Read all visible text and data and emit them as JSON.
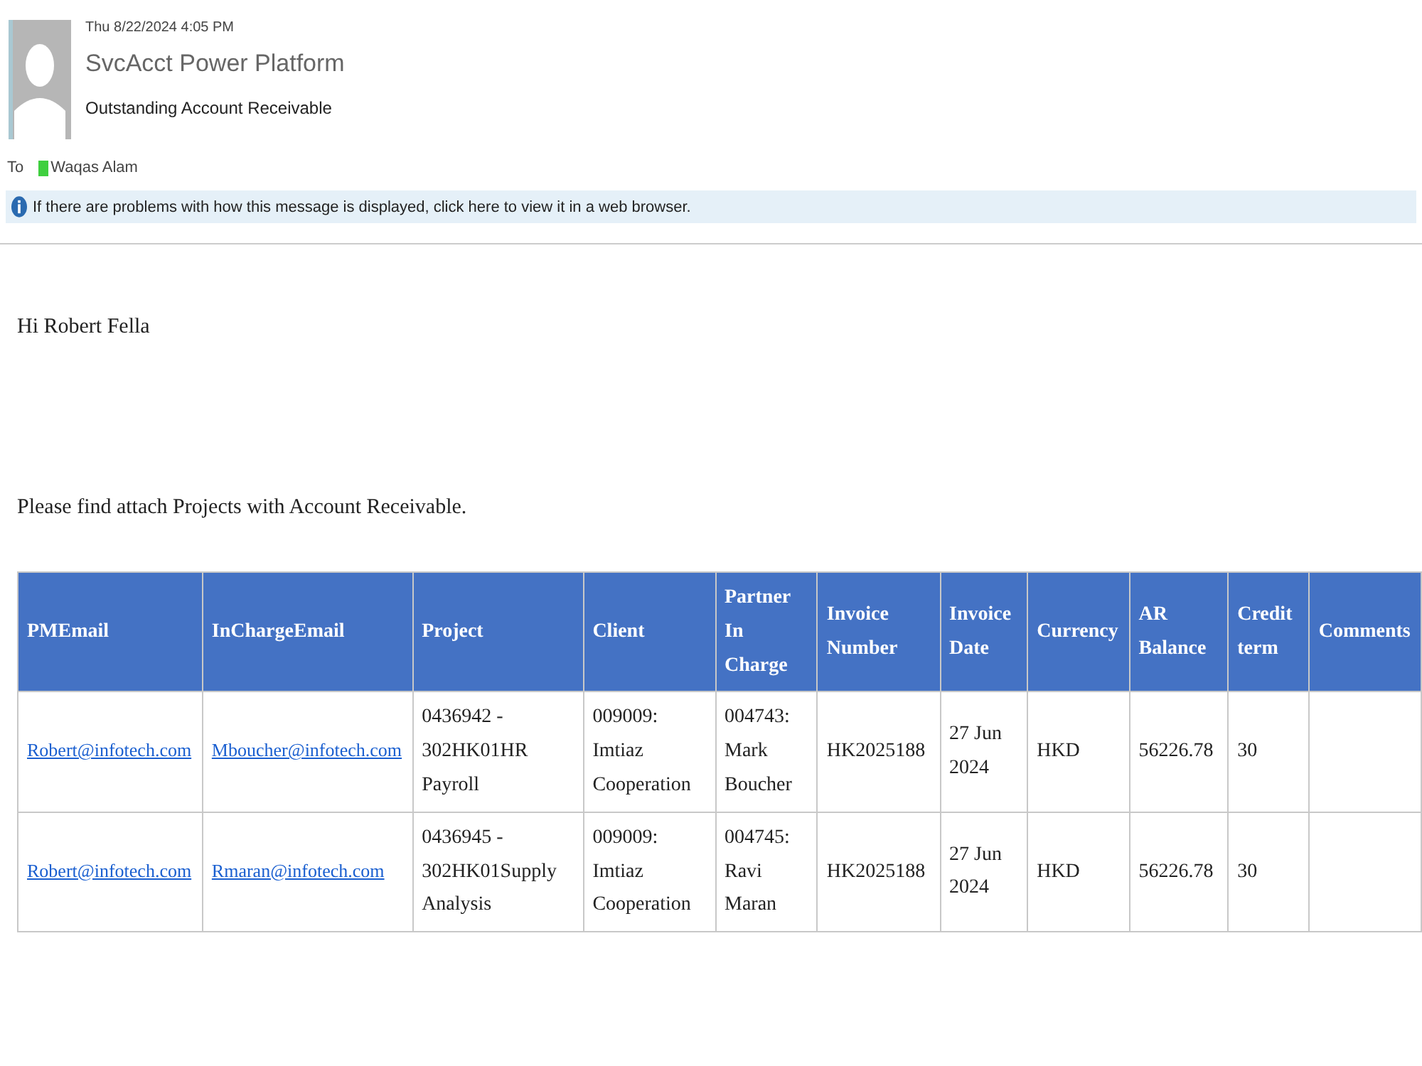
{
  "message": {
    "date": "Thu 8/22/2024 4:05 PM",
    "sender": "SvcAcct Power Platform",
    "subject": "Outstanding Account Receivable",
    "to_label": "To",
    "recipients": [
      {
        "name": "Waqas Alam",
        "color": "#3fcf3f"
      }
    ],
    "info_bar": "If there are problems with how this message is displayed, click here to view it in a web browser."
  },
  "body": {
    "greeting": "Hi Robert Fella",
    "intro": "Please find attach Projects with Account Receivable."
  },
  "table": {
    "columns": [
      {
        "label": "PMEmail",
        "kind": "link"
      },
      {
        "label": "InChargeEmail",
        "kind": "link"
      },
      {
        "label": "Project",
        "kind": "text"
      },
      {
        "label": "Client",
        "kind": "text"
      },
      {
        "label": "Partner In Charge",
        "kind": "text"
      },
      {
        "label": "Invoice Number",
        "kind": "text"
      },
      {
        "label": "Invoice Date",
        "kind": "text"
      },
      {
        "label": "Currency",
        "kind": "text"
      },
      {
        "label": "AR Balance",
        "kind": "text"
      },
      {
        "label": "Credit term",
        "kind": "text"
      },
      {
        "label": "Comments",
        "kind": "text"
      }
    ],
    "rows": [
      {
        "cells": [
          "Robert@infotech.com",
          "Mboucher@infotech.com",
          "0436942 - 302HK01HR Payroll",
          "009009: Imtiaz Cooperation",
          "004743: Mark Boucher",
          "HK2025188",
          "27 Jun 2024",
          "HKD",
          "56226.78",
          "30",
          ""
        ]
      },
      {
        "cells": [
          "Robert@infotech.com",
          "Rmaran@infotech.com",
          "0436945 - 302HK01Supply Analysis",
          "009009: Imtiaz Cooperation",
          "004745: Ravi Maran",
          "HK2025188",
          "27 Jun 2024",
          "HKD",
          "56226.78",
          "30",
          ""
        ]
      }
    ]
  }
}
